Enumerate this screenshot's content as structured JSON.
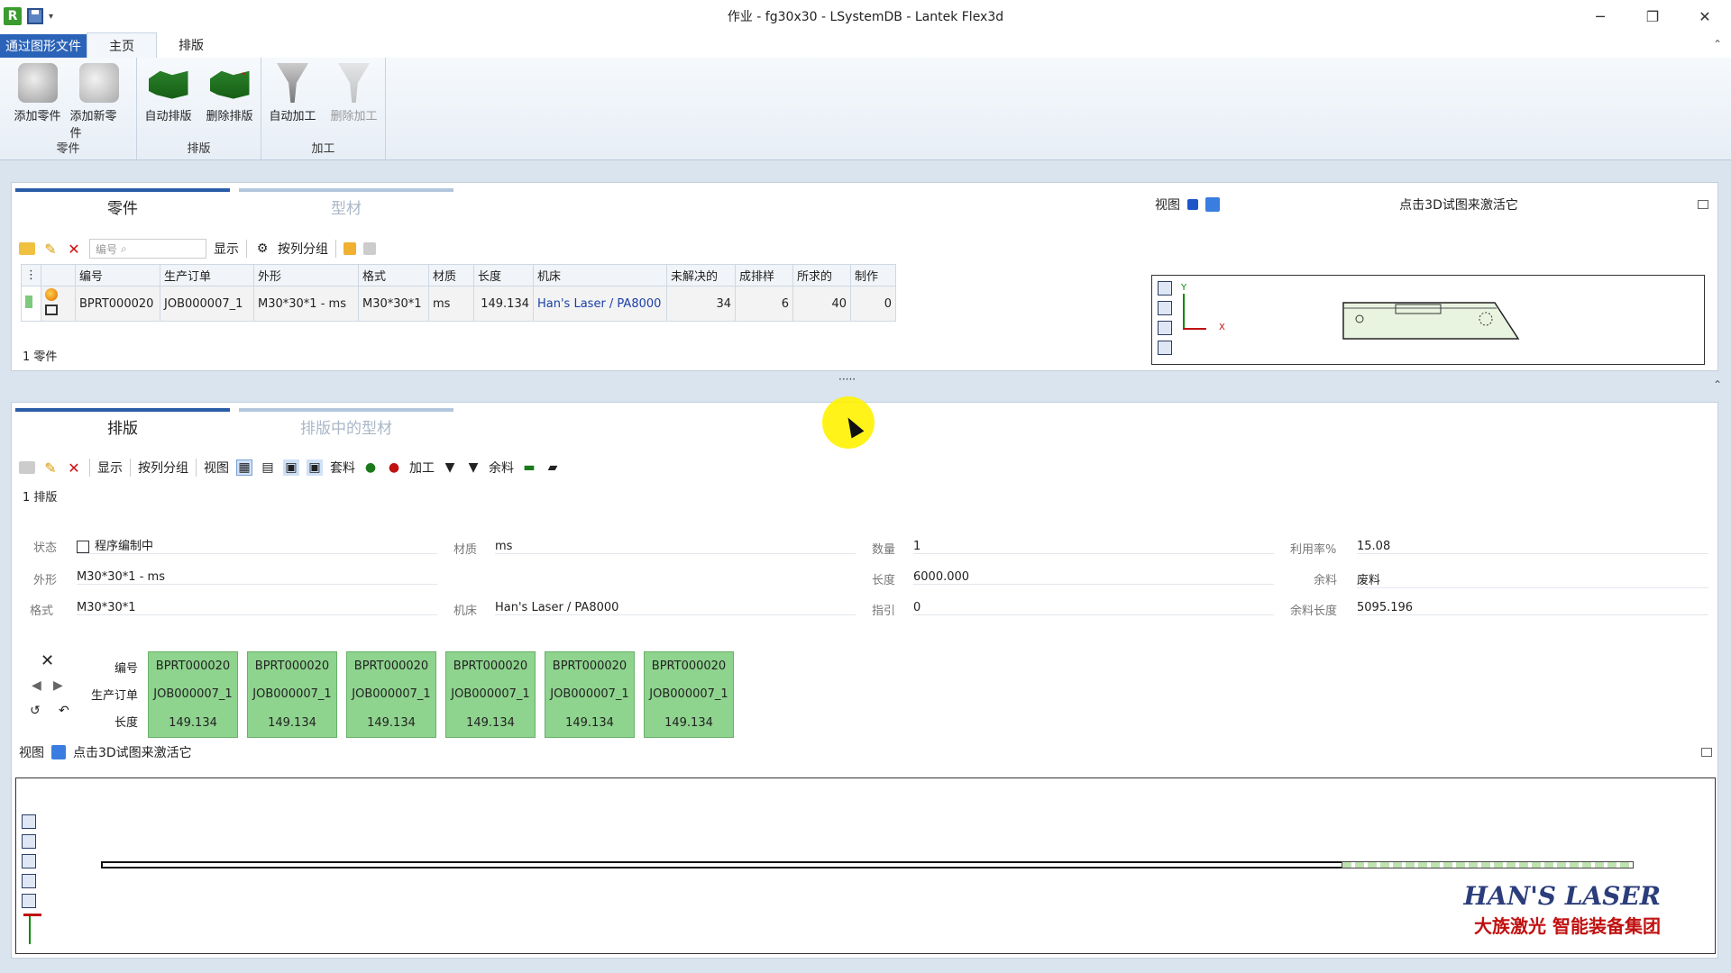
{
  "titlebar": {
    "title": "作业 - fg30x30 - LSystemDB - Lantek Flex3d",
    "minimize": "─",
    "maximize": "❐",
    "close": "✕"
  },
  "ribbon": {
    "file_tab": "通过图形文件",
    "tabs": [
      "主页",
      "排版"
    ],
    "collapse": "⌃",
    "groups": [
      {
        "label": "零件",
        "buttons": [
          "添加零件",
          "添加新零件"
        ]
      },
      {
        "label": "排版",
        "buttons": [
          "自动排版",
          "删除排版"
        ]
      },
      {
        "label": "加工",
        "buttons": [
          "自动加工",
          "删除加工"
        ]
      }
    ]
  },
  "parts_panel": {
    "tabs": [
      "零件",
      "型材"
    ],
    "search_placeholder": "编号",
    "show_label": "显示",
    "group_label": "按列分组",
    "columns": [
      "编号",
      "生产订单",
      "外形",
      "格式",
      "材质",
      "长度",
      "机床",
      "未解决的",
      "成排样",
      "所求的",
      "制作"
    ],
    "row": {
      "code": "BPRT000020",
      "order": "JOB000007_1",
      "shape": "M30*30*1 - ms",
      "format": "M30*30*1",
      "material": "ms",
      "length": "149.134",
      "machine": "Han's Laser / PA8000",
      "unresolved": "34",
      "nested": "6",
      "required": "40",
      "made": "0"
    },
    "count": "1 零件",
    "view_label": "视图",
    "activate_3d": "点击3D试图来激活它",
    "axis_y": "Y",
    "axis_x": "X"
  },
  "splitter": "·····",
  "nest_panel": {
    "tabs": [
      "排版",
      "排版中的型材"
    ],
    "show_label": "显示",
    "group_label": "按列分组",
    "view_label": "视图",
    "stock_label": "套料",
    "process_label": "加工",
    "remnant_label": "余料",
    "count": "1 排版",
    "fields": {
      "status_label": "状态",
      "status_value": "程序编制中",
      "material_label": "材质",
      "material_value": "ms",
      "qty_label": "数量",
      "qty_value": "1",
      "util_label": "利用率%",
      "util_value": "15.08",
      "shape_label": "外形",
      "shape_value": "M30*30*1 - ms",
      "length_label": "长度",
      "length_value": "6000.000",
      "remnant_label": "余料",
      "remnant_value": "废料",
      "format_label": "格式",
      "format_value": "M30*30*1",
      "machine_label": "机床",
      "machine_value": "Han's Laser / PA8000",
      "lead_label": "指引",
      "lead_value": "0",
      "remlen_label": "余料长度",
      "remlen_value": "5095.196"
    },
    "card_labels": [
      "编号",
      "生产订单",
      "长度"
    ],
    "cards": [
      {
        "code": "BPRT000020",
        "order": "JOB000007_1",
        "length": "149.134"
      },
      {
        "code": "BPRT000020",
        "order": "JOB000007_1",
        "length": "149.134"
      },
      {
        "code": "BPRT000020",
        "order": "JOB000007_1",
        "length": "149.134"
      },
      {
        "code": "BPRT000020",
        "order": "JOB000007_1",
        "length": "149.134"
      },
      {
        "code": "BPRT000020",
        "order": "JOB000007_1",
        "length": "149.134"
      },
      {
        "code": "BPRT000020",
        "order": "JOB000007_1",
        "length": "149.134"
      }
    ],
    "view_label2": "视图",
    "activate_3d": "点击3D试图来激活它"
  },
  "brand": {
    "line1": "HAN'S LASER",
    "line2": "大族激光 智能装备集团"
  },
  "colors": {
    "accent": "#2a5ca8",
    "card_green": "#8ed38e",
    "cursor_highlight": "#fff200"
  }
}
